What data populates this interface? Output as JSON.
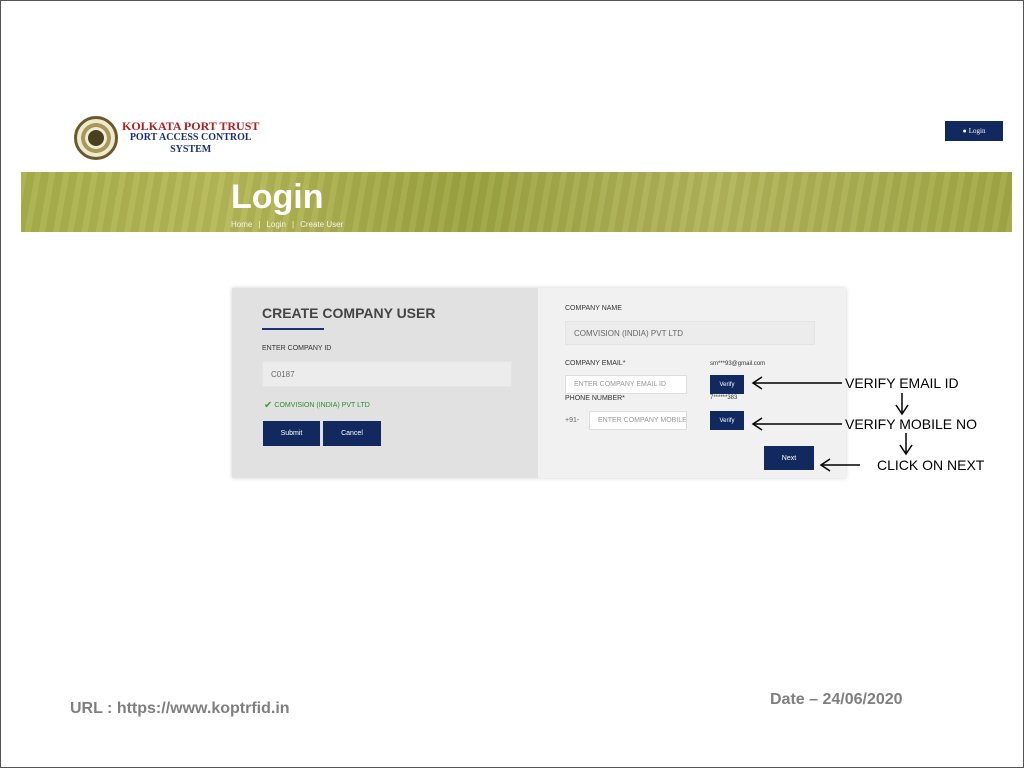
{
  "header": {
    "logo_line1": "KOLKATA PORT TRUST",
    "logo_line2": "PORT ACCESS CONTROL",
    "logo_line3": "SYSTEM",
    "login_button": "Login",
    "login_icon": "user-icon"
  },
  "banner": {
    "title": "Login",
    "breadcrumb": [
      "Home",
      "|",
      "Login",
      "|",
      "Create User"
    ]
  },
  "form": {
    "title": "CREATE COMPANY USER",
    "company_id_label": "ENTER COMPANY ID",
    "company_id_value": "C0187",
    "validation_message": "COMVISION (INDIA) PVT LTD",
    "submit_label": "Submit",
    "cancel_label": "Cancel",
    "company_name_label": "COMPANY NAME",
    "company_name_value": "COMVISION (INDIA) PVT LTD",
    "company_email_label": "COMPANY EMAIL*",
    "email_hint": "sm***93@gmail.com",
    "email_placeholder": "ENTER COMPANY EMAIL ID",
    "verify_email_label": "Verify",
    "phone_label": "PHONE NUMBER*",
    "phone_hint": "7******383",
    "phone_prefix": "+91-",
    "phone_placeholder": "ENTER COMPANY MOBILE",
    "verify_phone_label": "Verify",
    "next_label": "Next"
  },
  "annotations": {
    "verify_email": "VERIFY EMAIL ID",
    "verify_mobile": "VERIFY MOBILE NO",
    "click_next": "CLICK ON NEXT"
  },
  "footer": {
    "url": "URL : https://www.koptrfid.in",
    "date": "Date – 24/06/2020"
  },
  "colors": {
    "primary_button": "#11295f",
    "banner": "#a9b04a",
    "logo_red": "#b01e1e",
    "logo_blue": "#1c2f77",
    "valid_green": "#2e8b2e"
  }
}
